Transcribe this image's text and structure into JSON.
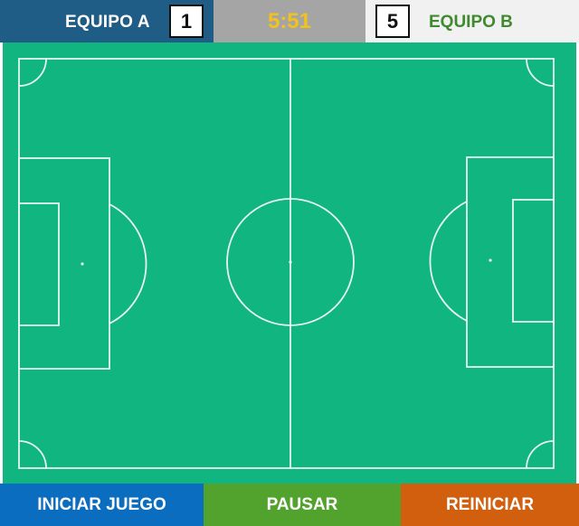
{
  "scoreboard": {
    "team_a": {
      "name": "EQUIPO A",
      "score": "1",
      "color": "#1f5d86"
    },
    "timer": {
      "value": "5:51",
      "color": "#f2c21a"
    },
    "team_b": {
      "name": "EQUIPO B",
      "score": "5",
      "color": "#3f8a2c"
    }
  },
  "field": {
    "color": "#10b57f",
    "line_color": "#e8f5ef"
  },
  "controls": {
    "start_label": "INICIAR JUEGO",
    "pause_label": "PAUSAR",
    "reset_label": "REINICIAR"
  }
}
